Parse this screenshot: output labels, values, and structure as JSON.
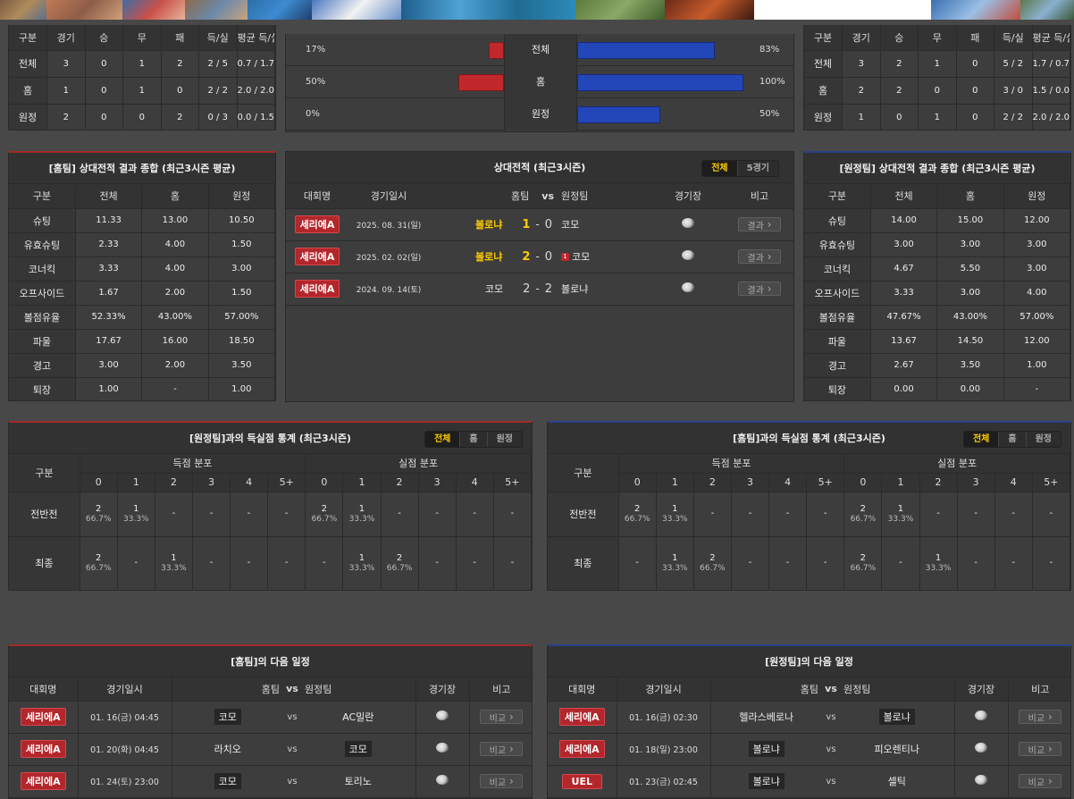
{
  "colors": {
    "bg": "#484848",
    "panel": "#3d3d3d",
    "home_accent": "#a52a2a",
    "away_accent": "#2a3f8a",
    "bar_red": "#c0282b",
    "bar_blue": "#2346b8",
    "highlight": "#ffcc00"
  },
  "top_banner": {
    "images": [
      "photo",
      "photo",
      "photo",
      "photo",
      "photo",
      "photo",
      "photo",
      "photo",
      "photo",
      "photo"
    ]
  },
  "home_record": {
    "headers": [
      "구분",
      "경기",
      "승",
      "무",
      "패",
      "득/실",
      "평균 득/실"
    ],
    "rows": [
      [
        "전체",
        "3",
        "0",
        "1",
        "2",
        "2 / 5",
        "0.7 / 1.7"
      ],
      [
        "홈",
        "1",
        "0",
        "1",
        "0",
        "2 / 2",
        "2.0 / 2.0"
      ],
      [
        "원정",
        "2",
        "0",
        "0",
        "2",
        "0 / 3",
        "0.0 / 1.5"
      ]
    ]
  },
  "away_record": {
    "headers": [
      "구분",
      "경기",
      "승",
      "무",
      "패",
      "득/실",
      "평균 득/실"
    ],
    "rows": [
      [
        "전체",
        "3",
        "2",
        "1",
        "0",
        "5 / 2",
        "1.7 / 0.7"
      ],
      [
        "홈",
        "2",
        "2",
        "0",
        "0",
        "3 / 0",
        "1.5 / 0.0"
      ],
      [
        "원정",
        "1",
        "0",
        "1",
        "0",
        "2 / 2",
        "2.0 / 2.0"
      ]
    ]
  },
  "win_rate": {
    "rows": [
      {
        "label": "전체",
        "left": "17%",
        "right": "83%",
        "left_val": 0.17,
        "right_val": 0.83
      },
      {
        "label": "홈",
        "left": "50%",
        "right": "100%",
        "left_val": 0.5,
        "right_val": 1.0
      },
      {
        "label": "원정",
        "left": "0%",
        "right": "50%",
        "left_val": 0.0,
        "right_val": 0.5
      }
    ]
  },
  "home_summary": {
    "title": "[홈팀] 상대전적 결과 종합 (최근3시즌 평균)",
    "headers": [
      "구분",
      "전체",
      "홈",
      "원정"
    ],
    "rows": [
      [
        "슈팅",
        "11.33",
        "13.00",
        "10.50"
      ],
      [
        "유효슈팅",
        "2.33",
        "4.00",
        "1.50"
      ],
      [
        "코너킥",
        "3.33",
        "4.00",
        "3.00"
      ],
      [
        "오프사이드",
        "1.67",
        "2.00",
        "1.50"
      ],
      [
        "볼점유율",
        "52.33%",
        "43.00%",
        "57.00%"
      ],
      [
        "파울",
        "17.67",
        "16.00",
        "18.50"
      ],
      [
        "경고",
        "3.00",
        "2.00",
        "3.50"
      ],
      [
        "퇴장",
        "1.00",
        "-",
        "1.00"
      ]
    ]
  },
  "away_summary": {
    "title": "[원정팀] 상대전적 결과 종합 (최근3시즌 평균)",
    "headers": [
      "구분",
      "전체",
      "홈",
      "원정"
    ],
    "rows": [
      [
        "슈팅",
        "14.00",
        "15.00",
        "12.00"
      ],
      [
        "유효슈팅",
        "3.00",
        "3.00",
        "3.00"
      ],
      [
        "코너킥",
        "4.67",
        "5.50",
        "3.00"
      ],
      [
        "오프사이드",
        "3.33",
        "3.00",
        "4.00"
      ],
      [
        "볼점유율",
        "47.67%",
        "43.00%",
        "57.00%"
      ],
      [
        "파울",
        "13.67",
        "14.50",
        "12.00"
      ],
      [
        "경고",
        "2.67",
        "3.50",
        "1.00"
      ],
      [
        "퇴장",
        "0.00",
        "0.00",
        "-"
      ]
    ]
  },
  "h2h": {
    "title": "상대전적 (최근3시즌)",
    "tabs": [
      "전체",
      "5경기"
    ],
    "headers": {
      "league": "대회명",
      "date": "경기일시",
      "home": "홈팀",
      "vs": "vs",
      "away": "원정팀",
      "venue": "경기장",
      "note": "비고"
    },
    "rows": [
      {
        "league": "세리에A",
        "date": "2025. 08. 31(일)",
        "home": "볼로냐",
        "hs": "1",
        "sep": "-",
        "as": "0",
        "away": "코모",
        "card": "",
        "btn": "결과"
      },
      {
        "league": "세리에A",
        "date": "2025. 02. 02(일)",
        "home": "볼로냐",
        "hs": "2",
        "sep": "-",
        "as": "0",
        "away": "코모",
        "card": "1",
        "btn": "결과"
      },
      {
        "league": "세리에A",
        "date": "2024. 09. 14(토)",
        "home": "코모",
        "hs": "2",
        "sep": "-",
        "as": "2",
        "away": "볼로냐",
        "card": "",
        "btn": "결과"
      }
    ]
  },
  "goal_left": {
    "title": "[원정팀]과의 득실점 통계 (최근3시즌)",
    "tabs": [
      "전체",
      "홈",
      "원정"
    ],
    "col_label": "구분",
    "scored": "득점 분포",
    "conceded": "실점 분포",
    "cols": [
      "0",
      "1",
      "2",
      "3",
      "4",
      "5+",
      "0",
      "1",
      "2",
      "3",
      "4",
      "5+"
    ],
    "rows": [
      {
        "label": "전반전",
        "cells": [
          [
            "2",
            "66.7%"
          ],
          [
            "1",
            "33.3%"
          ],
          [
            "-",
            ""
          ],
          [
            "-",
            ""
          ],
          [
            "-",
            ""
          ],
          [
            "-",
            ""
          ],
          [
            "2",
            "66.7%"
          ],
          [
            "1",
            "33.3%"
          ],
          [
            "-",
            ""
          ],
          [
            "-",
            ""
          ],
          [
            "-",
            ""
          ],
          [
            "-",
            ""
          ]
        ]
      },
      {
        "label": "최종",
        "cells": [
          [
            "2",
            "66.7%"
          ],
          [
            "-",
            ""
          ],
          [
            "1",
            "33.3%"
          ],
          [
            "-",
            ""
          ],
          [
            "-",
            ""
          ],
          [
            "-",
            ""
          ],
          [
            "-",
            ""
          ],
          [
            "1",
            "33.3%"
          ],
          [
            "2",
            "66.7%"
          ],
          [
            "-",
            ""
          ],
          [
            "-",
            ""
          ],
          [
            "-",
            ""
          ]
        ]
      }
    ]
  },
  "goal_right": {
    "title": "[홈팀]과의 득실점 통계 (최근3시즌)",
    "tabs": [
      "전체",
      "홈",
      "원정"
    ],
    "col_label": "구분",
    "scored": "득점 분포",
    "conceded": "실점 분포",
    "cols": [
      "0",
      "1",
      "2",
      "3",
      "4",
      "5+",
      "0",
      "1",
      "2",
      "3",
      "4",
      "5+"
    ],
    "rows": [
      {
        "label": "전반전",
        "cells": [
          [
            "2",
            "66.7%"
          ],
          [
            "1",
            "33.3%"
          ],
          [
            "-",
            ""
          ],
          [
            "-",
            ""
          ],
          [
            "-",
            ""
          ],
          [
            "-",
            ""
          ],
          [
            "2",
            "66.7%"
          ],
          [
            "1",
            "33.3%"
          ],
          [
            "-",
            ""
          ],
          [
            "-",
            ""
          ],
          [
            "-",
            ""
          ],
          [
            "-",
            ""
          ]
        ]
      },
      {
        "label": "최종",
        "cells": [
          [
            "-",
            ""
          ],
          [
            "1",
            "33.3%"
          ],
          [
            "2",
            "66.7%"
          ],
          [
            "-",
            ""
          ],
          [
            "-",
            ""
          ],
          [
            "-",
            ""
          ],
          [
            "2",
            "66.7%"
          ],
          [
            "-",
            ""
          ],
          [
            "1",
            "33.3%"
          ],
          [
            "-",
            ""
          ],
          [
            "-",
            ""
          ],
          [
            "-",
            ""
          ]
        ]
      }
    ]
  },
  "next_home": {
    "title": "[홈팀]의 다음 일정",
    "headers": {
      "league": "대회명",
      "date": "경기일시",
      "home": "홈팀",
      "vs": "vs",
      "away": "원정팀",
      "venue": "경기장",
      "note": "비고"
    },
    "rows": [
      {
        "league": "세리에A",
        "date": "01. 16(금) 04:45",
        "home": "코모",
        "home_box": true,
        "away": "AC밀란",
        "away_box": false,
        "btn": "비교"
      },
      {
        "league": "세리에A",
        "date": "01. 20(화) 04:45",
        "home": "라치오",
        "home_box": false,
        "away": "코모",
        "away_box": true,
        "btn": "비교"
      },
      {
        "league": "세리에A",
        "date": "01. 24(토) 23:00",
        "home": "코모",
        "home_box": true,
        "away": "토리노",
        "away_box": false,
        "btn": "비교"
      }
    ]
  },
  "next_away": {
    "title": "[원정팀]의 다음 일정",
    "headers": {
      "league": "대회명",
      "date": "경기일시",
      "home": "홈팀",
      "vs": "vs",
      "away": "원정팀",
      "venue": "경기장",
      "note": "비고"
    },
    "rows": [
      {
        "league": "세리에A",
        "date": "01. 16(금) 02:30",
        "home": "헬라스베로나",
        "home_box": false,
        "away": "볼로냐",
        "away_box": true,
        "btn": "비교"
      },
      {
        "league": "세리에A",
        "date": "01. 18(일) 23:00",
        "home": "볼로냐",
        "home_box": true,
        "away": "피오렌티나",
        "away_box": false,
        "btn": "비교"
      },
      {
        "league": "UEL",
        "date": "01. 23(금) 02:45",
        "home": "볼로냐",
        "home_box": true,
        "away": "셀틱",
        "away_box": false,
        "btn": "비교"
      }
    ]
  }
}
